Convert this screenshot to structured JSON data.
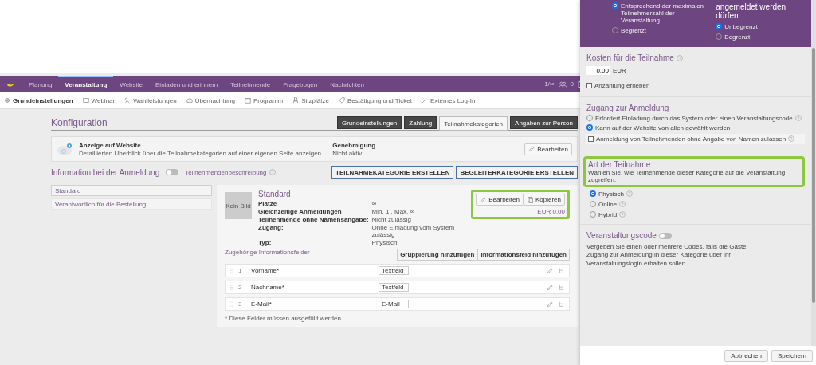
{
  "topbar": {
    "tabs": [
      {
        "label": "Planung",
        "selected": false
      },
      {
        "label": "Veranstaltung",
        "selected": true
      },
      {
        "label": "Website",
        "selected": false
      },
      {
        "label": "Einladen und erinnern",
        "selected": false
      },
      {
        "label": "Teilnehmende",
        "selected": false
      },
      {
        "label": "Fragebogen",
        "selected": false
      },
      {
        "label": "Nachrichten",
        "selected": false
      }
    ],
    "participants_count": "1/∞",
    "tasks_count": "0"
  },
  "subnav": [
    {
      "label": "Grundeinstellungen",
      "selected": true
    },
    {
      "label": "Webinar",
      "selected": false
    },
    {
      "label": "Wahlleistungen",
      "selected": false
    },
    {
      "label": "Übernachtung",
      "selected": false
    },
    {
      "label": "Programm",
      "selected": false
    },
    {
      "label": "Sitzplätze",
      "selected": false
    },
    {
      "label": "Bestätigung und Ticket",
      "selected": false
    },
    {
      "label": "Externes Log-In",
      "selected": false
    }
  ],
  "page_title": "Konfiguration",
  "page_tabs": [
    {
      "label": "Grundeinstellungen",
      "selected": false
    },
    {
      "label": "Zahlung",
      "selected": false
    },
    {
      "label": "Teilnahmekategorien",
      "selected": true
    },
    {
      "label": "Angaben zur Person",
      "selected": false
    }
  ],
  "website_card": {
    "title": "Anzeige auf Website",
    "description": "Detaillierten Überblick über die Teilnahmekategorien auf einer eigenen Seite anzeigen.",
    "approval_label": "Genehmigung",
    "approval_value": "Nicht aktiv",
    "button": "Bearbeiten"
  },
  "info_section": {
    "title": "Information bei der Anmeldung",
    "toggle_on": false,
    "toggle_label": "Teilnehmendenbeschreibung",
    "buttons": [
      "TEILNAHMEKATEGORIE ERSTELLEN",
      "BEGLEITERKATEGORIE ERSTELLEN"
    ]
  },
  "categories": [
    {
      "label": "Standard",
      "selected": true
    },
    {
      "label": "Verantwortlich für die Bestellung",
      "selected": false
    }
  ],
  "detail": {
    "image": "Kein Bild",
    "title": "Standard",
    "properties": [
      {
        "label": "Plätze",
        "value": "∞"
      },
      {
        "label": "Gleichzeitige Anmeldungen",
        "value": "Min. 1 , Max. ∞"
      },
      {
        "label": "Teilnehmende ohne Namensangabe:",
        "value": "Nicht zulässig"
      },
      {
        "label": "Zugang:",
        "value": "Ohne Einladung vom System zulässig"
      },
      {
        "label": "Typ:",
        "value": "Physisch"
      }
    ],
    "buttons": [
      "Bearbeiten",
      "Kopieren"
    ],
    "price": "EUR 0,00",
    "fields_title": "Zugehörige Informationsfelder",
    "field_buttons": [
      "Gruppierung hinzufügen",
      "Informationsfeld hinzufügen"
    ],
    "fields": [
      {
        "number": "1",
        "name": "Vorname*",
        "type": "Textfeld"
      },
      {
        "number": "2",
        "name": "Nachname*",
        "type": "Textfeld"
      },
      {
        "number": "3",
        "name": "E-Mail*",
        "type": "E-Mail"
      }
    ],
    "footnote": "* Diese Felder müssen ausgefüllt werden."
  },
  "dialog": {
    "capacity_options": [
      {
        "label": "Entsprechend der maximalen Teilnehmerzahl der Veranstaltung",
        "selected": true
      },
      {
        "label": "Begrenzt",
        "selected": false
      }
    ],
    "per_registration_heading": "angemeldet werden dürfen",
    "per_registration_options": [
      {
        "label": "Unbegrenzt",
        "selected": true
      },
      {
        "label": "Begrenzt",
        "selected": false
      }
    ],
    "cost_title": "Kosten für die Teilnahme",
    "cost_value": "0,00",
    "currency": "EUR",
    "deposit": {
      "label": "Anzahlung erheben",
      "checked": false
    },
    "access_title": "Zugang zur Anmeldung",
    "access_options": [
      {
        "label": "Erfordert Einladung durch das System oder einen Veranstaltungscode",
        "selected": false
      },
      {
        "label": "Kann auf der Website von allen gewählt werden",
        "selected": true
      }
    ],
    "anonymous": {
      "label": "Anmeldung von Teilnehmenden ohne Angabe von Namen zulassen",
      "checked": false
    },
    "type_title": "Art der Teilnahme",
    "type_description": "Wählen Sie, wie Teilnehmende dieser Kategorie auf die Veranstaltung zugreifen.",
    "type_options": [
      {
        "label": "Physisch",
        "selected": true
      },
      {
        "label": "Online",
        "selected": false
      },
      {
        "label": "Hybrid",
        "selected": false
      }
    ],
    "code_title": "Veranstaltungscode",
    "code_on": false,
    "code_description": "Vergeben Sie einen oder mehrere Codes, falls die Gäste Zugang zur Anmeldung in dieser Kategorie über ihr Veranstaltungslogin erhalten sollen",
    "buttons": [
      "Abbrechen",
      "Speichern"
    ]
  }
}
